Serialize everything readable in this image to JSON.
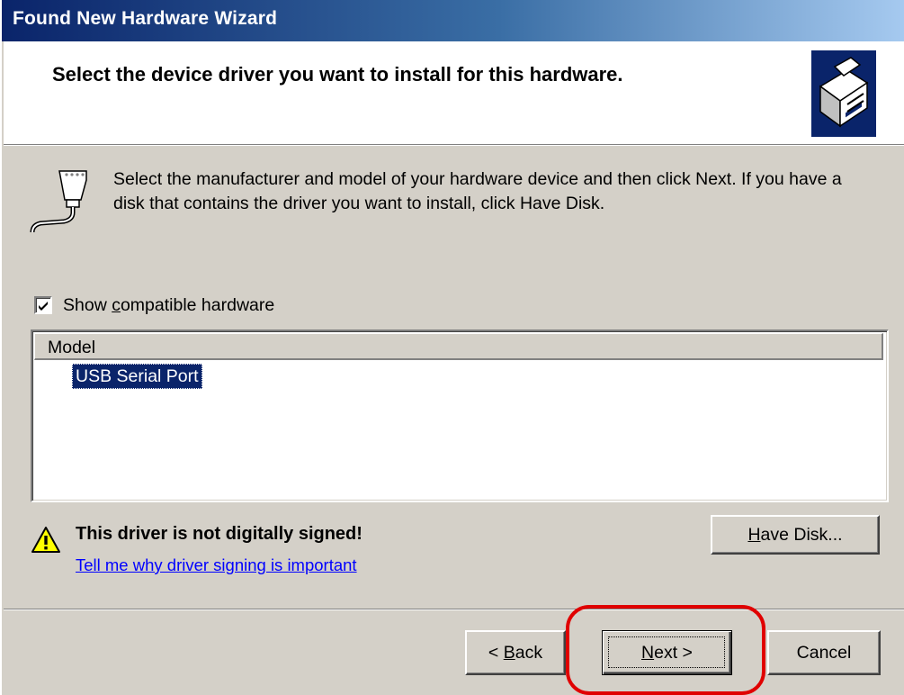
{
  "window": {
    "title": "Found New Hardware Wizard"
  },
  "header": {
    "title": "Select the device driver you want to install for this hardware.",
    "icon": "hardware-wizard-icon"
  },
  "instructions": {
    "text": "Select the manufacturer and model of your hardware device and then click Next. If you have a disk that contains the driver you want to install, click Have Disk.",
    "icon": "serial-port-connector-icon"
  },
  "compatible": {
    "checked": true,
    "label_pre": "Show ",
    "label_mn": "c",
    "label_post": "ompatible hardware"
  },
  "model_list": {
    "column_header": "Model",
    "items": [
      {
        "label": "USB Serial Port",
        "selected": true
      }
    ]
  },
  "warning": {
    "icon": "warning-icon",
    "title": "This driver is not digitally signed!",
    "link": "Tell me why driver signing is important"
  },
  "buttons": {
    "have_disk_mn": "H",
    "have_disk_rest": "ave Disk...",
    "back_pre": "< ",
    "back_mn": "B",
    "back_rest": "ack",
    "next_mn": "N",
    "next_rest": "ext >",
    "cancel": "Cancel"
  },
  "colors": {
    "titlebar_start": "#0a246a",
    "titlebar_end": "#a6caf0",
    "selection": "#0a246a",
    "highlight_ring": "#e00000",
    "link": "#0000ff"
  }
}
